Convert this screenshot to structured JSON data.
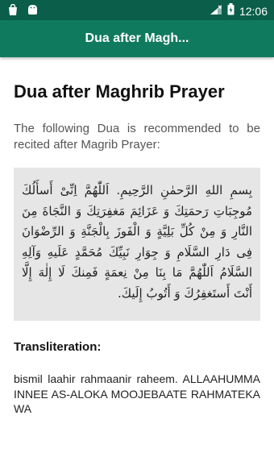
{
  "status_bar": {
    "time": "12:06",
    "left_icons": [
      "notification-bag-icon",
      "android-icon"
    ],
    "right_icons": [
      "signal-icon",
      "battery-icon"
    ]
  },
  "app_bar": {
    "title": "Dua after Magh..."
  },
  "page": {
    "heading": "Dua after Maghrib Prayer",
    "intro": "The following Dua is recommended to be recited after Magrib Prayer:",
    "arabic_text": "بِسمِ اللهِ الرَّحمٰنِ الرَّحِيمِ. اَللّٰهُمَّ اِنِّیْ أَسأَلُكَ مُوجِبَاتِ رَحمَتِكَ وَ عَزَائِمَ مَغفِرَتِكَ وَ النَّجَاةَ مِنَ النَّارِ وَ مِنْ كُلِّ بَلِيَّةٍ وَ الْفَوزَ بِالْجَنَّةِ وَ الرِّضْوَانَ فِى دَارِ السَّلَامِ وَ جِوَارِ نَبِيِّكَ مُحَمَّدٍ عَلَيهِ وَآلِهِ السَّلَامُ اَللّٰهُمَّ مَا بِنَا مِنْ نِعمَةٍ فَمِنكَ لَا إِلٰهَ إِلَّا أَنْتَ أَستَغفِرُكَ وَ أَتُوبُ إِلَيكَ.",
    "transliteration_heading": "Transliteration:",
    "transliteration": "bismil laahir rahmaanir raheem. ALLAAHUMMA INNEE AS-ALOKA MOOJEBAATE RAHMATEKA WA"
  },
  "colors": {
    "status_bar": "#0a5e4a",
    "app_bar": "#0f7a5e",
    "arabic_box": "#e6e6e6"
  }
}
